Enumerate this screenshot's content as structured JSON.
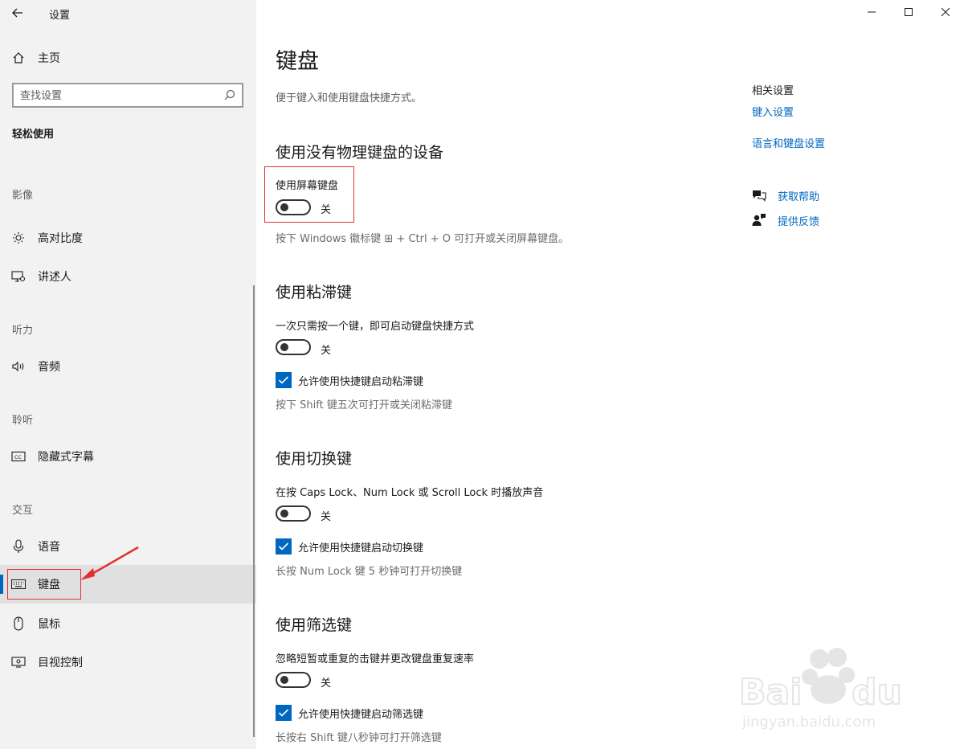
{
  "app": {
    "title": "设置"
  },
  "sidebar": {
    "home_label": "主页",
    "search_placeholder": "查找设置",
    "category": "轻松使用",
    "groups": {
      "vision": "影像",
      "hearing": "听力",
      "listening": "聆听",
      "interaction": "交互"
    },
    "items": {
      "high_contrast": "高对比度",
      "narrator": "讲述人",
      "audio": "音频",
      "captions": "隐藏式字幕",
      "speech": "语音",
      "keyboard": "键盘",
      "mouse": "鼠标",
      "eye_control": "目视控制"
    },
    "selected": "keyboard"
  },
  "main": {
    "title": "键盘",
    "description": "便于键入和使用键盘快捷方式。",
    "on_screen": {
      "heading": "使用没有物理键盘的设备",
      "toggle_label": "使用屏幕键盘",
      "state": "关",
      "hint": "按下 Windows 徽标键 ⊞ + Ctrl + O 可打开或关闭屏幕键盘。"
    },
    "sticky": {
      "heading": "使用粘滞键",
      "toggle_label": "一次只需按一个键，即可启动键盘快捷方式",
      "state": "关",
      "checkbox_label": "允许使用快捷键启动粘滞键",
      "hint": "按下 Shift 键五次可打开或关闭粘滞键"
    },
    "toggle_keys": {
      "heading": "使用切换键",
      "toggle_label": "在按 Caps Lock、Num Lock 或 Scroll Lock 时播放声音",
      "state": "关",
      "checkbox_label": "允许使用快捷键启动切换键",
      "hint": "长按 Num Lock 键 5 秒钟可打开切换键"
    },
    "filter": {
      "heading": "使用筛选键",
      "toggle_label": "忽略短暂或重复的击键并更改键盘重复速率",
      "state": "关",
      "checkbox_label": "允许使用快捷键启动筛选键",
      "hint": "长按右 Shift 键八秒钟可打开筛选键"
    }
  },
  "related": {
    "heading": "相关设置",
    "typing_link": "键入设置",
    "language_link": "语言和键盘设置",
    "help": "获取帮助",
    "feedback": "提供反馈"
  },
  "colors": {
    "accent": "#0067c0",
    "annotation": "#e03030"
  }
}
